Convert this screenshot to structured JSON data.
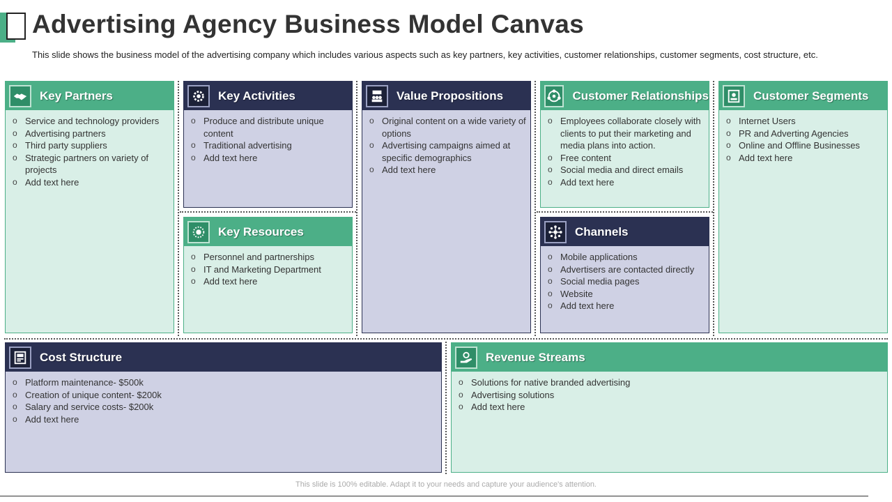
{
  "header": {
    "title": "Advertising Agency Business Model Canvas",
    "subtitle": "This slide shows the business model of the advertising company which includes various aspects such as key partners, key activities, customer relationships, customer segments, cost structure, etc."
  },
  "blocks": {
    "key_partners": {
      "title": "Key Partners",
      "icon": "handshake-icon",
      "items": [
        "Service and technology providers",
        "Advertising partners",
        "Third party suppliers",
        "Strategic partners on variety of projects",
        "Add text here"
      ]
    },
    "key_activities": {
      "title": "Key Activities",
      "icon": "gear-icon",
      "items": [
        "Produce and distribute unique content",
        "Traditional advertising",
        "Add text here"
      ]
    },
    "key_resources": {
      "title": "Key Resources",
      "icon": "resources-icon",
      "items": [
        "Personnel and partnerships",
        "IT and Marketing Department",
        "Add text here"
      ]
    },
    "value_propositions": {
      "title": "Value Propositions",
      "icon": "team-icon",
      "items": [
        "Original content on a wide variety of options",
        "Advertising campaigns aimed at specific demographics",
        "Add text here"
      ]
    },
    "customer_relationships": {
      "title": "Customer Relationships",
      "icon": "relationship-icon",
      "items": [
        "Employees collaborate closely with clients to put their marketing and media plans into action.",
        "Free content",
        "Social media and direct emails",
        "Add text here"
      ]
    },
    "channels": {
      "title": "Channels",
      "icon": "network-icon",
      "items": [
        "Mobile applications",
        "Advertisers are contacted directly",
        "Social media pages",
        "Website",
        "Add text here"
      ]
    },
    "customer_segments": {
      "title": "Customer Segments",
      "icon": "segments-icon",
      "items": [
        "Internet Users",
        "PR and Adverting Agencies",
        "Online and Offline Businesses",
        "Add text here"
      ]
    },
    "cost_structure": {
      "title": "Cost Structure",
      "icon": "cost-icon",
      "items": [
        "Platform maintenance- $500k",
        "Creation of unique content- $200k",
        "Salary and service costs- $200k",
        "Add text here"
      ]
    },
    "revenue_streams": {
      "title": "Revenue Streams",
      "icon": "revenue-icon",
      "items": [
        "Solutions for native branded advertising",
        "Advertising solutions",
        "Add text here"
      ]
    }
  },
  "footer": {
    "note": "This slide is 100% editable. Adapt it to your needs and capture your audience's attention."
  },
  "colors": {
    "green_header": "#4caf87",
    "green_body": "#d9efe7",
    "navy_header": "#2b3152",
    "lavender_body": "#cfd1e4"
  }
}
